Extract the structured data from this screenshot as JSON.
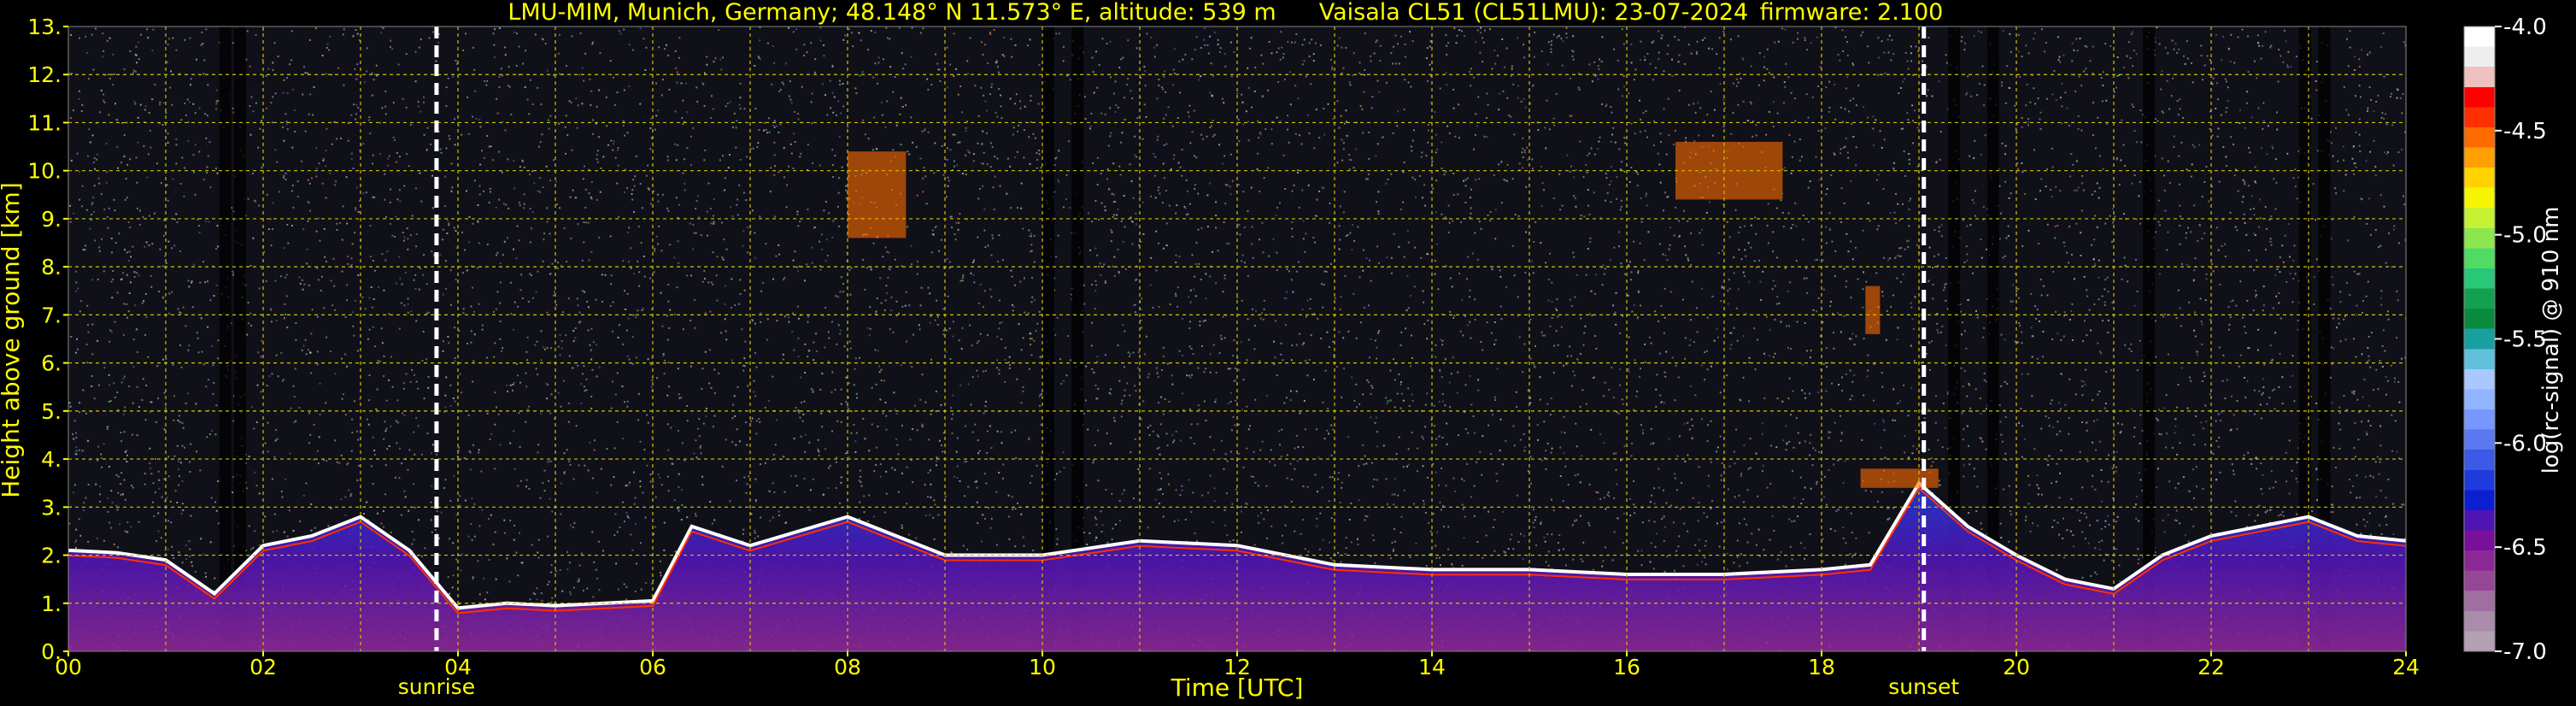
{
  "chart_data": {
    "type": "heatmap",
    "title_parts": {
      "site": "LMU-MIM, Munich, Germany; 48.148° N 11.573° E, altitude: 539 m",
      "instrument": "Vaisala CL51 (CL51LMU): 23-07-2024",
      "firmware": "firmware: 2.100"
    },
    "xlabel": "Time [UTC]",
    "ylabel": "Height above ground [km]",
    "xlim": [
      0,
      24
    ],
    "ylim": [
      0,
      13
    ],
    "x_tick_labels": [
      "00",
      "02",
      "04",
      "06",
      "08",
      "10",
      "12",
      "14",
      "16",
      "18",
      "20",
      "22",
      "24"
    ],
    "y_tick_labels": [
      "0.",
      "1.",
      "2.",
      "3.",
      "4.",
      "5.",
      "6.",
      "7.",
      "8.",
      "9.",
      "10.",
      "11.",
      "12.",
      "13."
    ],
    "grid": true,
    "events": [
      {
        "label": "sunrise",
        "time": 3.78
      },
      {
        "label": "sunset",
        "time": 19.05
      }
    ],
    "colorbar": {
      "label": "log(rc-signal) @ 910 nm",
      "range": [
        -7.0,
        -4.0
      ],
      "tick_labels": [
        "-4.0",
        "-4.5",
        "-5.0",
        "-5.5",
        "-6.0",
        "-6.5",
        "-7.0"
      ],
      "colors": [
        "#ffffff",
        "#eeeeee",
        "#f0c0c0",
        "#ff0000",
        "#ff3000",
        "#ff6a00",
        "#ffa000",
        "#ffd200",
        "#f5f500",
        "#c8f032",
        "#8ce650",
        "#50dc64",
        "#28c878",
        "#14a050",
        "#0a8a3c",
        "#18a0a0",
        "#60c0dc",
        "#a8c8ff",
        "#90b4ff",
        "#7896ff",
        "#5a78f0",
        "#3c5ae6",
        "#1e3cdc",
        "#0a1ed2",
        "#5014b4",
        "#78109a",
        "#8c2896",
        "#964696",
        "#a06ea0",
        "#aa8caa",
        "#b4a0b4"
      ]
    },
    "layer_top_km": [
      [
        0.0,
        2.1
      ],
      [
        0.5,
        2.05
      ],
      [
        1.0,
        1.9
      ],
      [
        1.5,
        1.2
      ],
      [
        2.0,
        2.2
      ],
      [
        2.5,
        2.4
      ],
      [
        3.0,
        2.8
      ],
      [
        3.5,
        2.1
      ],
      [
        4.0,
        0.9
      ],
      [
        4.5,
        1.0
      ],
      [
        5.0,
        0.95
      ],
      [
        5.5,
        1.0
      ],
      [
        6.0,
        1.05
      ],
      [
        6.4,
        2.6
      ],
      [
        7.0,
        2.2
      ],
      [
        7.5,
        2.5
      ],
      [
        8.0,
        2.8
      ],
      [
        9.0,
        2.0
      ],
      [
        10.0,
        2.0
      ],
      [
        11.0,
        2.3
      ],
      [
        12.0,
        2.2
      ],
      [
        13.0,
        1.8
      ],
      [
        14.0,
        1.7
      ],
      [
        15.0,
        1.7
      ],
      [
        16.0,
        1.6
      ],
      [
        17.0,
        1.6
      ],
      [
        18.0,
        1.7
      ],
      [
        18.5,
        1.8
      ],
      [
        19.0,
        3.5
      ],
      [
        19.5,
        2.6
      ],
      [
        20.0,
        2.0
      ],
      [
        20.5,
        1.5
      ],
      [
        21.0,
        1.3
      ],
      [
        21.5,
        2.0
      ],
      [
        22.0,
        2.4
      ],
      [
        22.5,
        2.6
      ],
      [
        23.0,
        2.8
      ],
      [
        23.5,
        2.4
      ],
      [
        24.0,
        2.3
      ]
    ],
    "cloud_patches": [
      {
        "t0": 8.0,
        "t1": 8.6,
        "z0": 8.6,
        "z1": 10.4
      },
      {
        "t0": 16.5,
        "t1": 17.6,
        "z0": 9.4,
        "z1": 10.6
      },
      {
        "t0": 18.45,
        "t1": 18.6,
        "z0": 6.6,
        "z1": 7.6
      },
      {
        "t0": 18.4,
        "t1": 19.2,
        "z0": 3.4,
        "z1": 3.8
      }
    ]
  }
}
